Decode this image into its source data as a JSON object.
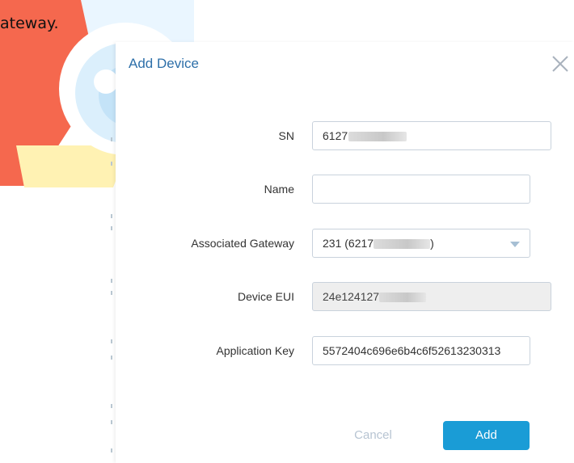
{
  "background": {
    "text": "ateway."
  },
  "dialog": {
    "title": "Add Device",
    "close_icon": "close-icon",
    "fields": {
      "sn": {
        "label": "SN",
        "value": "6127"
      },
      "name": {
        "label": "Name",
        "value": ""
      },
      "gateway": {
        "label": "Associated Gateway",
        "value_prefix": "231 (6217",
        "value_suffix": ")"
      },
      "eui": {
        "label": "Device EUI",
        "value": "24e124127"
      },
      "app_key": {
        "label": "Application Key",
        "value": "5572404c696e6b4c6f52613230313"
      }
    },
    "buttons": {
      "cancel": "Cancel",
      "add": "Add"
    }
  },
  "colors": {
    "title": "#2d6fa9",
    "primary": "#1a9cd6",
    "cancel_text": "#b7c4d2",
    "readonly_bg": "#eeeeee"
  }
}
